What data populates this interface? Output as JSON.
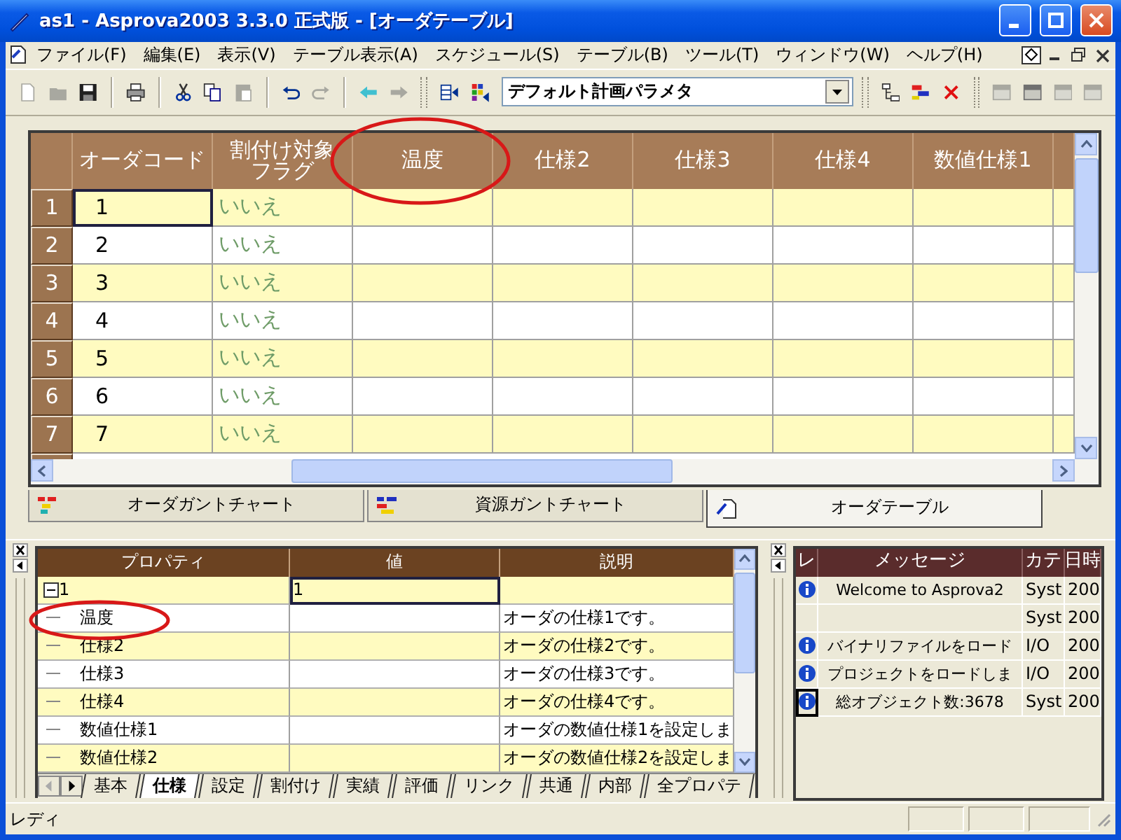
{
  "window": {
    "title": "as1 - Asprova2003 3.3.0 正式版 - [オーダテーブル]"
  },
  "menu": [
    "ファイル(F)",
    "編集(E)",
    "表示(V)",
    "テーブル表示(A)",
    "スケジュール(S)",
    "テーブル(B)",
    "ツール(T)",
    "ウィンドウ(W)",
    "ヘルプ(H)"
  ],
  "toolbar": {
    "left": [
      [
        {
          "kind": "new",
          "disabled": true
        },
        {
          "kind": "open",
          "disabled": true
        },
        {
          "kind": "save",
          "disabled": false
        }
      ],
      [
        {
          "kind": "print",
          "disabled": false
        }
      ],
      [
        {
          "kind": "cut",
          "disabled": false
        },
        {
          "kind": "copy",
          "disabled": false
        },
        {
          "kind": "paste",
          "disabled": true
        }
      ],
      [
        {
          "kind": "undo",
          "disabled": false
        },
        {
          "kind": "redo",
          "disabled": true
        }
      ],
      [
        {
          "kind": "back",
          "disabled": false
        },
        {
          "kind": "forward",
          "disabled": true
        }
      ],
      [
        {
          "kind": "table-in",
          "disabled": false
        },
        {
          "kind": "grid-in",
          "disabled": false
        }
      ]
    ],
    "dropdown": {
      "value": "デフォルト計画パラメタ"
    },
    "right": [
      [
        {
          "kind": "tree",
          "disabled": false
        },
        {
          "kind": "bars",
          "disabled": false
        },
        {
          "kind": "delete",
          "disabled": false
        }
      ],
      [
        {
          "kind": "layout",
          "disabled": true
        },
        {
          "kind": "layout",
          "disabled": false
        },
        {
          "kind": "layout",
          "disabled": true
        },
        {
          "kind": "layout",
          "disabled": true
        }
      ]
    ]
  },
  "order_table": {
    "columns": [
      {
        "lines": [
          "オーダコード"
        ]
      },
      {
        "lines": [
          "割付け対象",
          "フラグ"
        ]
      },
      {
        "lines": [
          "温度"
        ]
      },
      {
        "lines": [
          "仕様2"
        ]
      },
      {
        "lines": [
          "仕様3"
        ]
      },
      {
        "lines": [
          "仕様4"
        ]
      },
      {
        "lines": [
          "数値仕様1"
        ]
      }
    ],
    "rows": [
      {
        "number": "1",
        "code": "1",
        "flag": "いいえ",
        "selected": true
      },
      {
        "number": "2",
        "code": "2",
        "flag": "いいえ",
        "selected": false
      },
      {
        "number": "3",
        "code": "3",
        "flag": "いいえ",
        "selected": false
      },
      {
        "number": "4",
        "code": "4",
        "flag": "いいえ",
        "selected": false
      },
      {
        "number": "5",
        "code": "5",
        "flag": "いいえ",
        "selected": false
      },
      {
        "number": "6",
        "code": "6",
        "flag": "いいえ",
        "selected": false
      },
      {
        "number": "7",
        "code": "7",
        "flag": "いいえ",
        "selected": false
      }
    ]
  },
  "view_tabs": [
    {
      "label": "オーダガントチャート",
      "kind": "order-gantt",
      "selected": false
    },
    {
      "label": "資源ガントチャート",
      "kind": "resource-gantt",
      "selected": false
    },
    {
      "label": "オーダテーブル",
      "kind": "table",
      "selected": true
    }
  ],
  "properties": {
    "columns": [
      "プロパティ",
      "値",
      "説明"
    ],
    "root": {
      "label": "1",
      "value": "1",
      "expanded": true,
      "children": [
        {
          "label": "温度",
          "description": "オーダの仕様1です。"
        },
        {
          "label": "仕様2",
          "description": "オーダの仕様2です。"
        },
        {
          "label": "仕様3",
          "description": "オーダの仕様3です。"
        },
        {
          "label": "仕様4",
          "description": "オーダの仕様4です。"
        },
        {
          "label": "数値仕様1",
          "description": "オーダの数値仕様1を設定しま"
        },
        {
          "label": "数値仕様2",
          "description": "オーダの数値仕様2を設定しま"
        }
      ]
    },
    "tabs": [
      {
        "label": "基本",
        "selected": false
      },
      {
        "label": "仕様",
        "selected": true
      },
      {
        "label": "設定",
        "selected": false
      },
      {
        "label": "割付け",
        "selected": false
      },
      {
        "label": "実績",
        "selected": false
      },
      {
        "label": "評価",
        "selected": false
      },
      {
        "label": "リンク",
        "selected": false
      },
      {
        "label": "共通",
        "selected": false
      },
      {
        "label": "内部",
        "selected": false
      },
      {
        "label": "全プロパテ",
        "selected": false
      }
    ]
  },
  "log": {
    "columns": [
      "レ",
      "メッセージ",
      "カテ",
      "日時"
    ],
    "rows": [
      {
        "kind": "info",
        "message": "Welcome to Asprova2",
        "category": "Syst",
        "time": "200",
        "selected": false
      },
      {
        "kind": "none",
        "category": "Syst",
        "time": "200",
        "selected": false
      },
      {
        "kind": "info",
        "message": "バイナリファイルをロード",
        "category": "I/O",
        "time": "200",
        "selected": false
      },
      {
        "kind": "info",
        "message": "プロジェクトをロードしま",
        "category": "I/O",
        "time": "200",
        "selected": false
      },
      {
        "kind": "info",
        "message": "総オブジェクト数:3678",
        "category": "Syst",
        "time": "200",
        "selected": true
      }
    ]
  },
  "status_bar": {
    "text": "レディ"
  }
}
